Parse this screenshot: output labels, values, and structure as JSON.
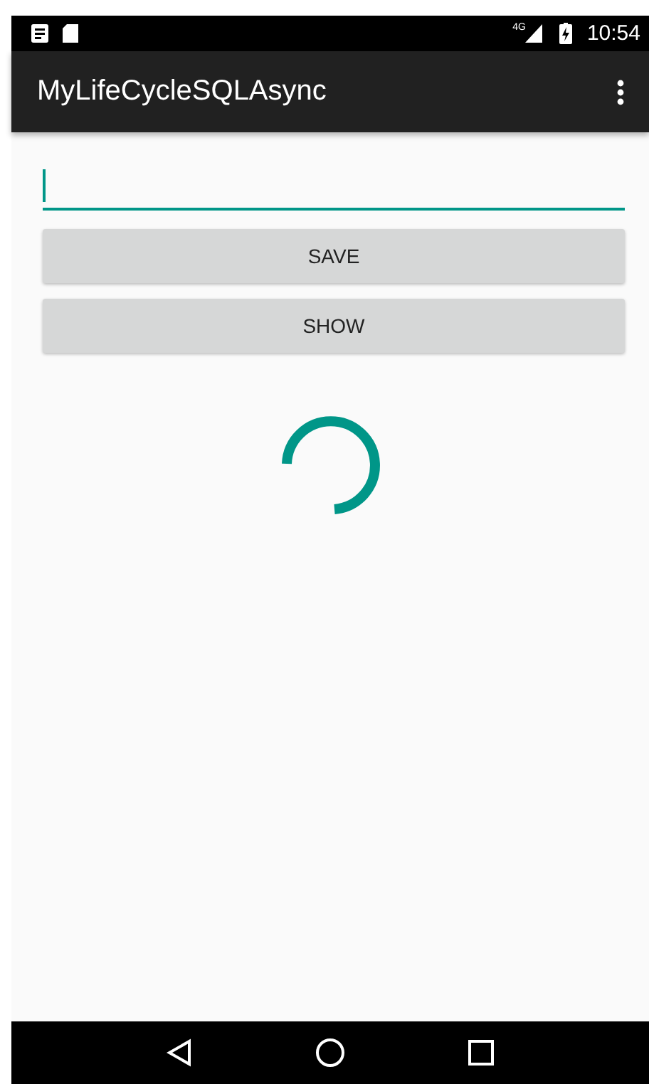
{
  "status_bar": {
    "network": "4G",
    "time": "10:54"
  },
  "app_bar": {
    "title": "MyLifeCycleSQLAsync"
  },
  "text_field": {
    "focused": true
  },
  "buttons": [
    "SAVE",
    "SHOW"
  ],
  "progress": {
    "visible": true
  }
}
